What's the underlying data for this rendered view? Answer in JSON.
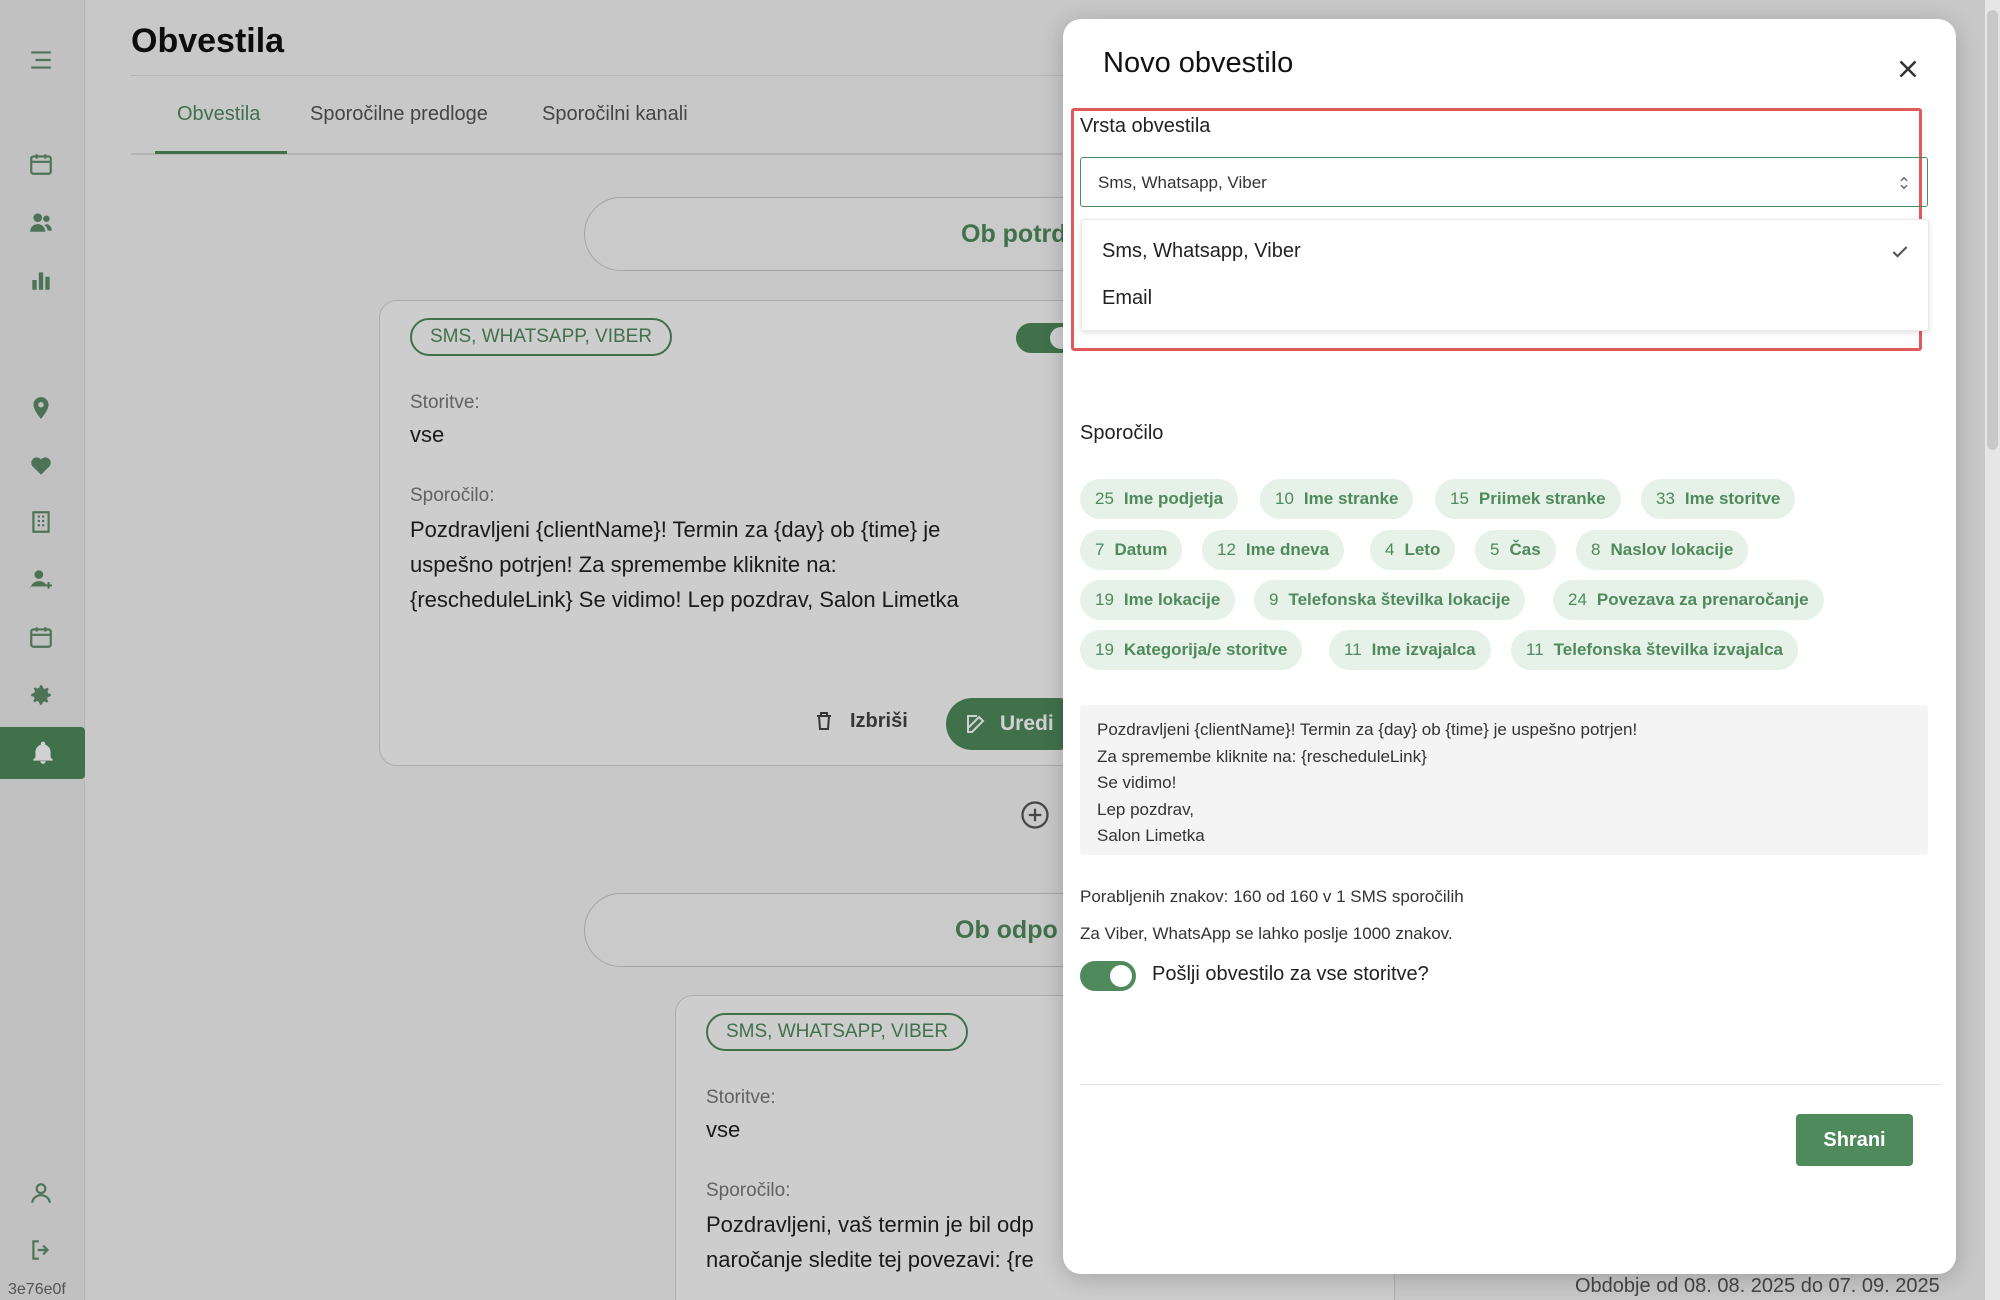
{
  "sidebar": {
    "version": "3e76e0f",
    "icons": [
      "menu-icon",
      "calendar-icon",
      "users-icon",
      "chart-icon",
      "location-icon",
      "heart-hand-icon",
      "building-icon",
      "user-plus-icon",
      "calendar-2-icon",
      "gear-icon",
      "bell-icon",
      "profile-icon",
      "logout-icon"
    ]
  },
  "page": {
    "title": "Obvestila",
    "tabs": [
      "Obvestila",
      "Sporočilne predloge",
      "Sporočilni kanali"
    ],
    "active_tab": "Obvestila",
    "section1_title": "Ob potrd",
    "section2_title": "Ob odpo",
    "card1": {
      "tag": "SMS, WHATSAPP, VIBER",
      "services_label": "Storitve:",
      "services_value": "vse",
      "message_label": "Sporočilo:",
      "message_lines": [
        "Pozdravljeni {clientName}! Termin za {day} ob {time} je",
        "uspešno potrjen! Za spremembe kliknite na:",
        "{rescheduleLink} Se vidimo! Lep pozdrav, Salon Limetka"
      ],
      "delete_label": "Izbriši",
      "edit_label": "Uredi"
    },
    "card2": {
      "tag": "SMS, WHATSAPP, VIBER",
      "services_label": "Storitve:",
      "services_value": "vse",
      "message_label": "Sporočilo:",
      "message_lines": [
        "Pozdravljeni, vaš termin je bil odp",
        "naročanje sledite tej povezavi: {re"
      ]
    },
    "period": "Obdobje od 08. 08. 2025 do 07. 09. 2025"
  },
  "modal": {
    "title": "Novo obvestilo",
    "type_label": "Vrsta obvestila",
    "type_selected": "Sms, Whatsapp, Viber",
    "type_options": [
      "Sms, Whatsapp, Viber",
      "Email"
    ],
    "message_label": "Sporočilo",
    "chips": [
      {
        "n": "25",
        "label": "Ime podjetja"
      },
      {
        "n": "10",
        "label": "Ime stranke"
      },
      {
        "n": "15",
        "label": "Priimek stranke"
      },
      {
        "n": "33",
        "label": "Ime storitve"
      },
      {
        "n": "7",
        "label": "Datum"
      },
      {
        "n": "12",
        "label": "Ime dneva"
      },
      {
        "n": "4",
        "label": "Leto"
      },
      {
        "n": "5",
        "label": "Čas"
      },
      {
        "n": "8",
        "label": "Naslov lokacije"
      },
      {
        "n": "19",
        "label": "Ime lokacije"
      },
      {
        "n": "9",
        "label": "Telefonska številka lokacije"
      },
      {
        "n": "24",
        "label": "Povezava za prenaročanje"
      },
      {
        "n": "19",
        "label": "Kategorija/e storitve"
      },
      {
        "n": "11",
        "label": "Ime izvajalca"
      },
      {
        "n": "11",
        "label": "Telefonska številka izvajalca"
      }
    ],
    "message_lines": [
      "Pozdravljeni {clientName}! Termin za {day} ob {time} je uspešno potrjen!",
      "Za spremembe kliknite na: {rescheduleLink}",
      "Se vidimo!",
      "Lep pozdrav,",
      "Salon Limetka"
    ],
    "char_count": "Porabljenih znakov: 160 od 160 v 1 SMS sporočilih",
    "viber_note": "Za Viber, WhatsApp se lahko poslje 1000 znakov.",
    "toggle_label": "Pošlji obvestilo za vse storitve?",
    "toggle_on": true,
    "save_label": "Shrani"
  },
  "colors": {
    "accent": "#4f8a5c",
    "chip_bg": "#e6f1e8",
    "highlight": "#e05a5a"
  }
}
